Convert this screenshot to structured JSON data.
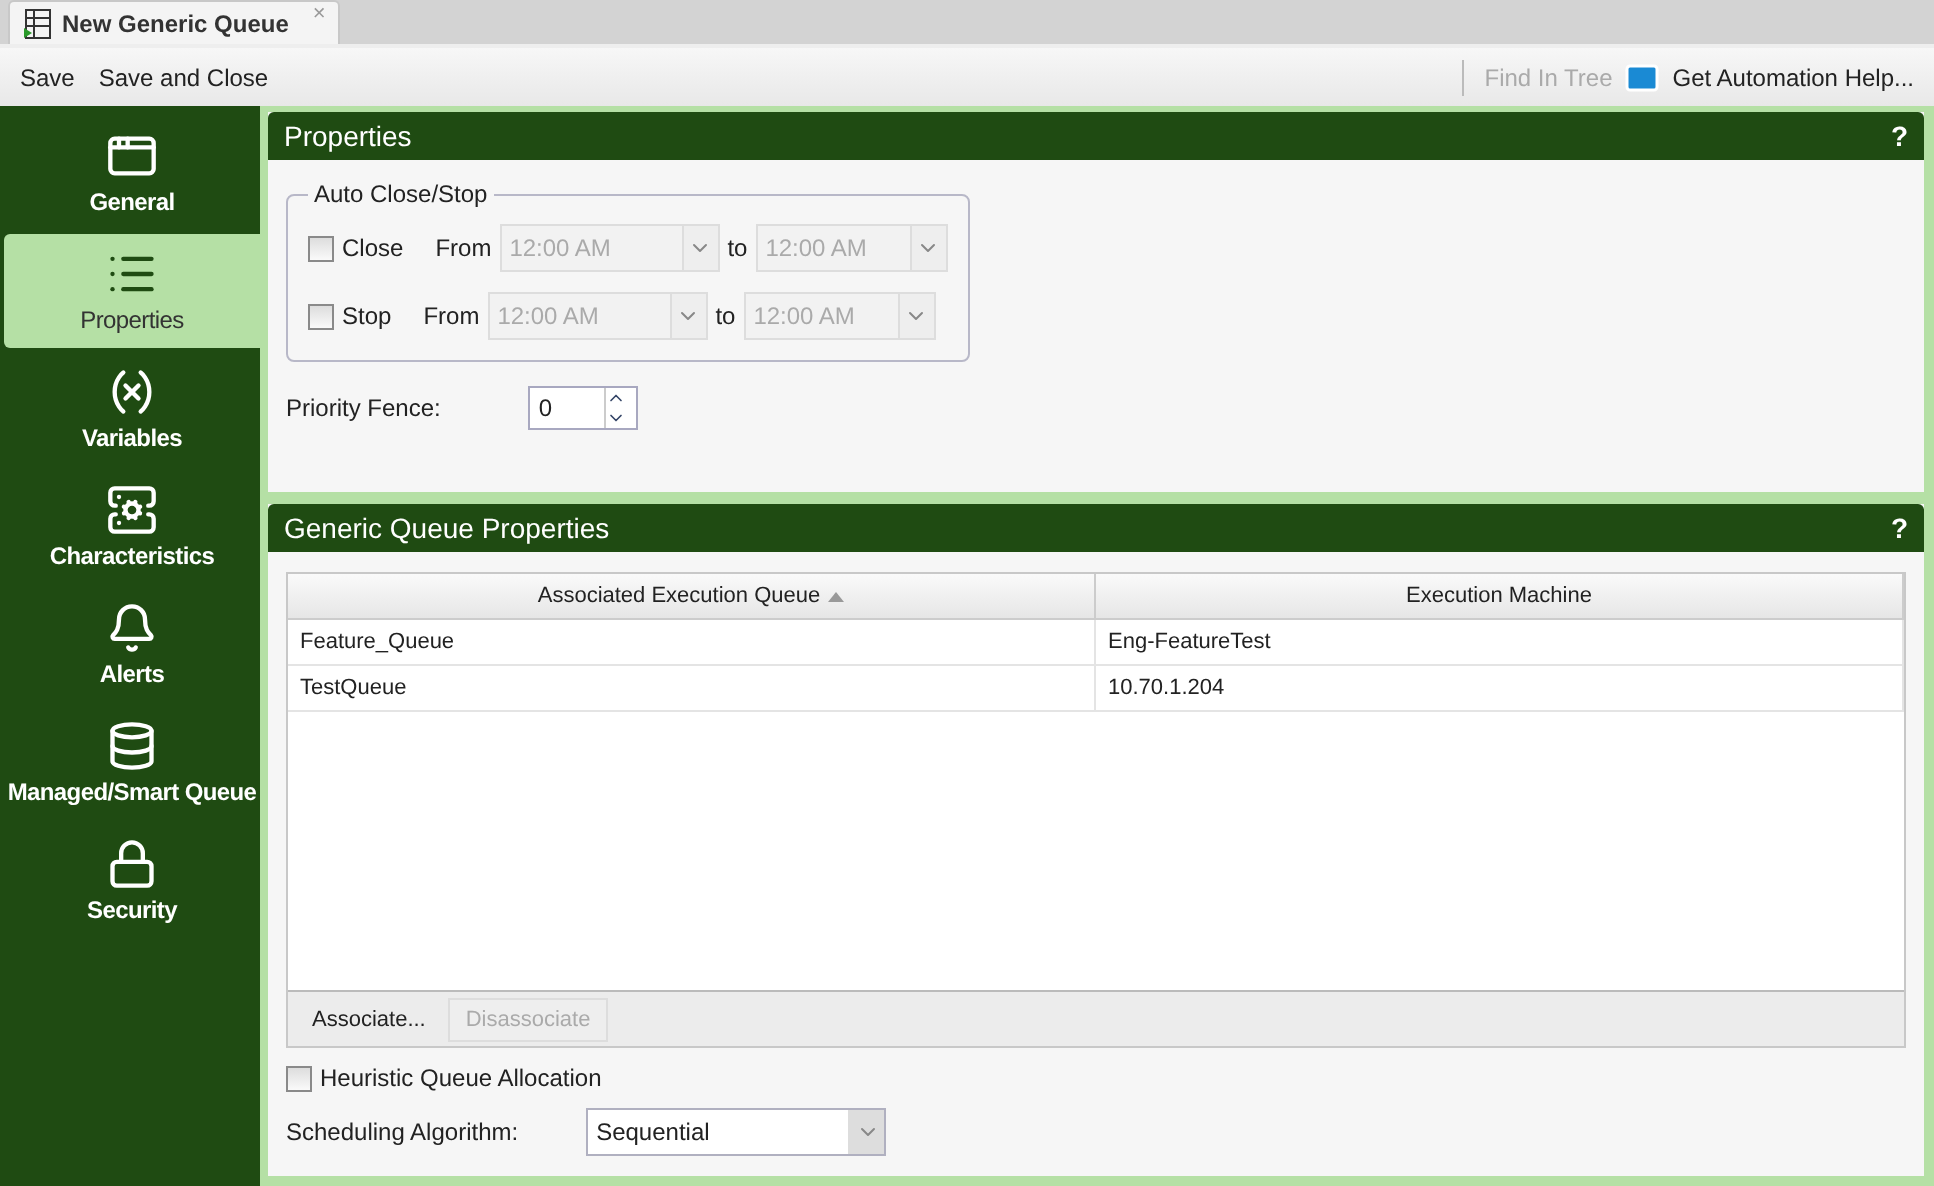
{
  "tab": {
    "title": "New Generic Queue",
    "close": "×"
  },
  "toolbar": {
    "left": [
      {
        "label": "Save",
        "disabled": false
      },
      {
        "label": "Save and Close",
        "disabled": false
      }
    ],
    "find": {
      "label": "Find In Tree",
      "disabled": true
    },
    "help": {
      "label": "Get Automation Help..."
    }
  },
  "sidebar": {
    "items": [
      {
        "label": "General",
        "selected": false
      },
      {
        "label": "Properties",
        "selected": true
      },
      {
        "label": "Variables",
        "selected": false
      },
      {
        "label": "Characteristics",
        "selected": false
      },
      {
        "label": "Alerts",
        "selected": false
      },
      {
        "label": "Managed/Smart Queue",
        "selected": false
      },
      {
        "label": "Security",
        "selected": false
      }
    ]
  },
  "properties_panel": {
    "title": "Properties",
    "help": "?",
    "auto_close_stop": {
      "legend": "Auto Close/Stop",
      "rows": [
        {
          "label": "Close",
          "checked": false,
          "from_label": "From",
          "from_value": "12:00 AM",
          "to_label": "to",
          "to_value": "12:00 AM",
          "disabled": true
        },
        {
          "label": "Stop",
          "checked": false,
          "from_label": "From",
          "from_value": "12:00 AM",
          "to_label": "to",
          "to_value": "12:00 AM",
          "disabled": true
        }
      ]
    },
    "priority_fence": {
      "label": "Priority Fence:",
      "value": "0"
    }
  },
  "generic_panel": {
    "title": "Generic Queue Properties",
    "help": "?",
    "table": {
      "columns": [
        {
          "label": "Associated Execution Queue",
          "sorted": true
        },
        {
          "label": "Execution Machine",
          "sorted": false
        }
      ],
      "rows": [
        [
          "Feature_Queue",
          "Eng-FeatureTest"
        ],
        [
          "TestQueue",
          "10.70.1.204"
        ]
      ]
    },
    "buttons": [
      {
        "label": "Associate...",
        "disabled": false
      },
      {
        "label": "Disassociate",
        "disabled": true
      }
    ],
    "heuristic": {
      "label": "Heuristic Queue Allocation",
      "checked": false
    },
    "scheduling": {
      "label": "Scheduling Algorithm:",
      "value": "Sequential"
    }
  }
}
